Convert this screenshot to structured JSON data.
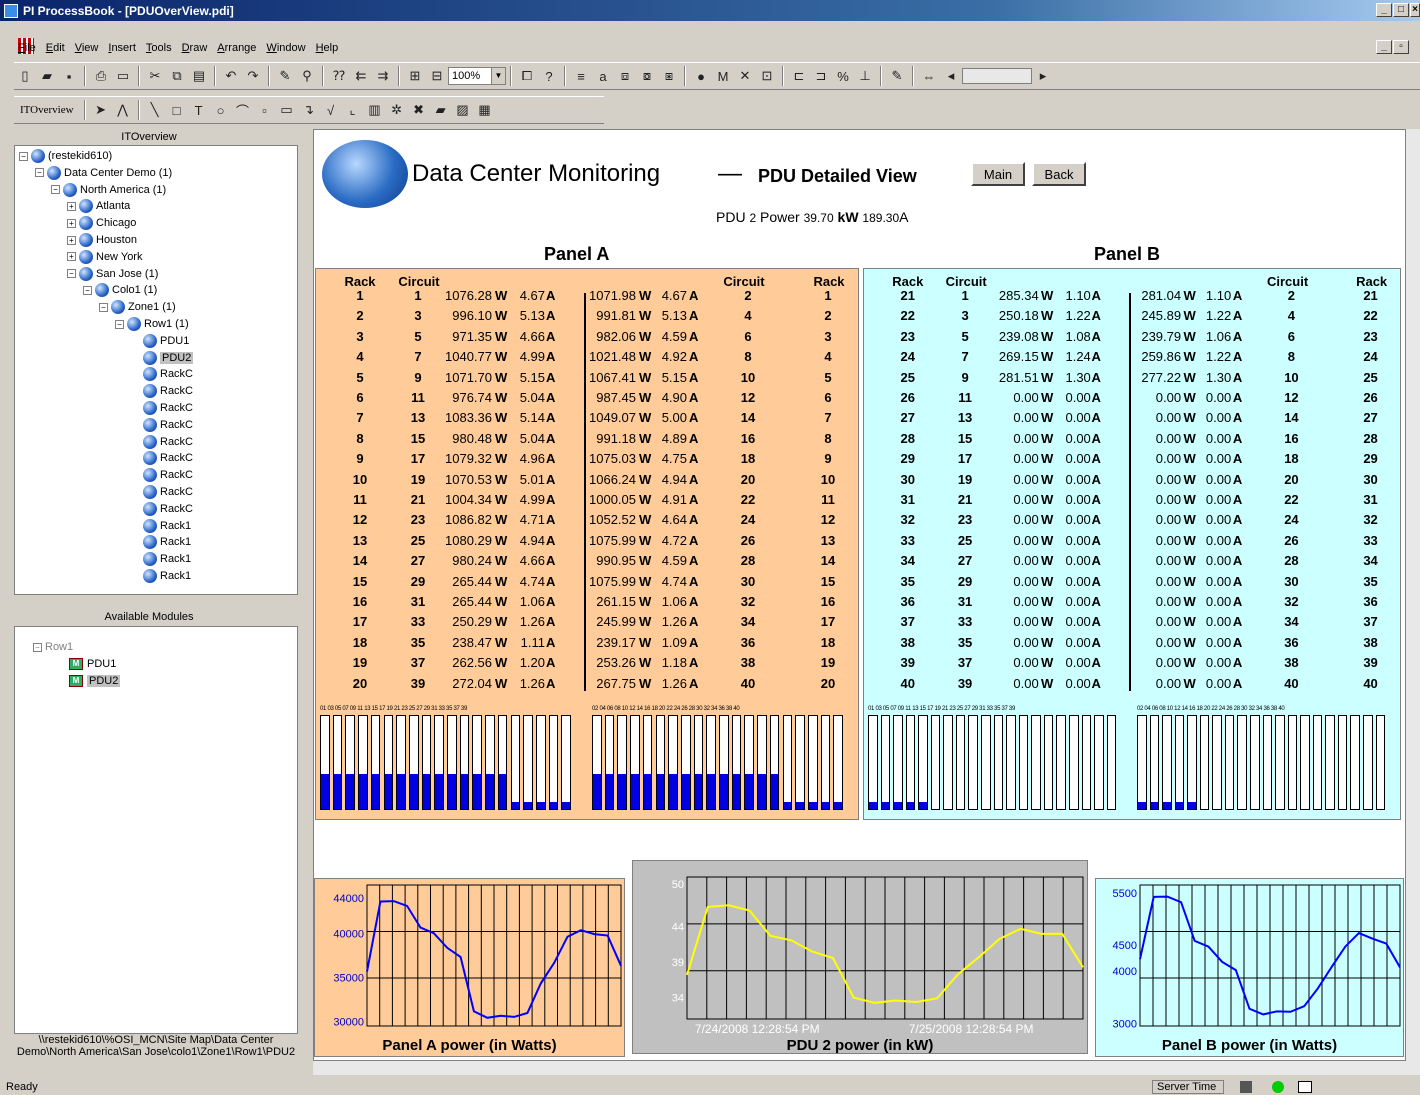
{
  "window": {
    "title": "PI ProcessBook - [PDUOverView.pdi]"
  },
  "menu": [
    "File",
    "Edit",
    "View",
    "Insert",
    "Tools",
    "Draw",
    "Arrange",
    "Window",
    "Help"
  ],
  "toolbar": {
    "zoom": "100%",
    "display_name": "ITOverview"
  },
  "tree_pane": {
    "title": "ITOverview",
    "nodes": [
      {
        "label": "(restekid610)",
        "depth": 0,
        "expander": "−"
      },
      {
        "label": "Data Center Demo (1)",
        "depth": 1,
        "expander": "−"
      },
      {
        "label": "North America (1)",
        "depth": 2,
        "expander": "−"
      },
      {
        "label": "Atlanta",
        "depth": 3,
        "expander": "+"
      },
      {
        "label": "Chicago",
        "depth": 3,
        "expander": "+"
      },
      {
        "label": "Houston",
        "depth": 3,
        "expander": "+"
      },
      {
        "label": "New York",
        "depth": 3,
        "expander": "+"
      },
      {
        "label": "San Jose (1)",
        "depth": 3,
        "expander": "−"
      },
      {
        "label": "Colo1 (1)",
        "depth": 4,
        "expander": "−"
      },
      {
        "label": "Zone1 (1)",
        "depth": 5,
        "expander": "−"
      },
      {
        "label": "Row1 (1)",
        "depth": 6,
        "expander": "−"
      },
      {
        "label": "PDU1",
        "depth": 7,
        "expander": ""
      },
      {
        "label": "PDU2",
        "depth": 7,
        "expander": "",
        "selected": true
      },
      {
        "label": "RackC",
        "depth": 7,
        "expander": ""
      },
      {
        "label": "RackC",
        "depth": 7,
        "expander": ""
      },
      {
        "label": "RackC",
        "depth": 7,
        "expander": ""
      },
      {
        "label": "RackC",
        "depth": 7,
        "expander": ""
      },
      {
        "label": "RackC",
        "depth": 7,
        "expander": ""
      },
      {
        "label": "RackC",
        "depth": 7,
        "expander": ""
      },
      {
        "label": "RackC",
        "depth": 7,
        "expander": ""
      },
      {
        "label": "RackC",
        "depth": 7,
        "expander": ""
      },
      {
        "label": "RackC",
        "depth": 7,
        "expander": ""
      },
      {
        "label": "Rack1",
        "depth": 7,
        "expander": ""
      },
      {
        "label": "Rack1",
        "depth": 7,
        "expander": ""
      },
      {
        "label": "Rack1",
        "depth": 7,
        "expander": ""
      },
      {
        "label": "Rack1",
        "depth": 7,
        "expander": ""
      }
    ]
  },
  "modules_pane": {
    "title": "Available Modules",
    "root": "Row1",
    "items": [
      "PDU1",
      "PDU2"
    ],
    "path": "\\\\restekid610\\%OSI_MCN\\Site Map\\Data Center Demo\\North America\\San Jose\\colo1\\Zone1\\Row1\\PDU2"
  },
  "display": {
    "title": "Data Center Monitoring",
    "dash": "—",
    "subtitle": "PDU Detailed View",
    "main_button": "Main",
    "back_button": "Back",
    "pdu_prefix": "PDU",
    "pdu_number": "2",
    "power_label": "Power",
    "kw_value": "39.70",
    "kw_unit": "kW",
    "amp_value": "189.30",
    "amp_unit": "A",
    "rack_hdr": "Rack",
    "circuit_hdr": "Circuit",
    "w_unit": "W",
    "a_unit": "A",
    "bar_ticks_odd": "01 03 05 07 09 11 13 15 17 19 21 23 25 27 29 31 33 35 37 39",
    "bar_ticks_even": "02 04 06 08 10 12 14 16 18 20 22 24 26 28 30 32 34 36 38 40"
  },
  "panel_a": {
    "title": "Panel A",
    "rows": [
      {
        "rack": "1",
        "lc": "1",
        "lw": "1076.28",
        "la": "4.67",
        "rw": "1071.98",
        "ra": "4.67",
        "rc": "2",
        "rr": "1"
      },
      {
        "rack": "2",
        "lc": "3",
        "lw": "996.10",
        "la": "5.13",
        "rw": "991.81",
        "ra": "5.13",
        "rc": "4",
        "rr": "2"
      },
      {
        "rack": "3",
        "lc": "5",
        "lw": "971.35",
        "la": "4.66",
        "rw": "982.06",
        "ra": "4.59",
        "rc": "6",
        "rr": "3"
      },
      {
        "rack": "4",
        "lc": "7",
        "lw": "1040.77",
        "la": "4.99",
        "rw": "1021.48",
        "ra": "4.92",
        "rc": "8",
        "rr": "4"
      },
      {
        "rack": "5",
        "lc": "9",
        "lw": "1071.70",
        "la": "5.15",
        "rw": "1067.41",
        "ra": "5.15",
        "rc": "10",
        "rr": "5"
      },
      {
        "rack": "6",
        "lc": "11",
        "lw": "976.74",
        "la": "5.04",
        "rw": "987.45",
        "ra": "4.90",
        "rc": "12",
        "rr": "6"
      },
      {
        "rack": "7",
        "lc": "13",
        "lw": "1083.36",
        "la": "5.14",
        "rw": "1049.07",
        "ra": "5.00",
        "rc": "14",
        "rr": "7"
      },
      {
        "rack": "8",
        "lc": "15",
        "lw": "980.48",
        "la": "5.04",
        "rw": "991.18",
        "ra": "4.89",
        "rc": "16",
        "rr": "8"
      },
      {
        "rack": "9",
        "lc": "17",
        "lw": "1079.32",
        "la": "4.96",
        "rw": "1075.03",
        "ra": "4.75",
        "rc": "18",
        "rr": "9"
      },
      {
        "rack": "10",
        "lc": "19",
        "lw": "1070.53",
        "la": "5.01",
        "rw": "1066.24",
        "ra": "4.94",
        "rc": "20",
        "rr": "10"
      },
      {
        "rack": "11",
        "lc": "21",
        "lw": "1004.34",
        "la": "4.99",
        "rw": "1000.05",
        "ra": "4.91",
        "rc": "22",
        "rr": "11"
      },
      {
        "rack": "12",
        "lc": "23",
        "lw": "1086.82",
        "la": "4.71",
        "rw": "1052.52",
        "ra": "4.64",
        "rc": "24",
        "rr": "12"
      },
      {
        "rack": "13",
        "lc": "25",
        "lw": "1080.29",
        "la": "4.94",
        "rw": "1075.99",
        "ra": "4.72",
        "rc": "26",
        "rr": "13"
      },
      {
        "rack": "14",
        "lc": "27",
        "lw": "980.24",
        "la": "4.66",
        "rw": "990.95",
        "ra": "4.59",
        "rc": "28",
        "rr": "14"
      },
      {
        "rack": "15",
        "lc": "29",
        "lw": "265.44",
        "la": "4.74",
        "rw": "1075.99",
        "ra": "4.74",
        "rc": "30",
        "rr": "15"
      },
      {
        "rack": "16",
        "lc": "31",
        "lw": "265.44",
        "la": "1.06",
        "rw": "261.15",
        "ra": "1.06",
        "rc": "32",
        "rr": "16"
      },
      {
        "rack": "17",
        "lc": "33",
        "lw": "250.29",
        "la": "1.26",
        "rw": "245.99",
        "ra": "1.26",
        "rc": "34",
        "rr": "17"
      },
      {
        "rack": "18",
        "lc": "35",
        "lw": "238.47",
        "la": "1.11",
        "rw": "239.17",
        "ra": "1.09",
        "rc": "36",
        "rr": "18"
      },
      {
        "rack": "19",
        "lc": "37",
        "lw": "262.56",
        "la": "1.20",
        "rw": "253.26",
        "ra": "1.18",
        "rc": "38",
        "rr": "19"
      },
      {
        "rack": "20",
        "lc": "39",
        "lw": "272.04",
        "la": "1.26",
        "rw": "267.75",
        "ra": "1.26",
        "rc": "40",
        "rr": "20"
      }
    ],
    "bar_levels_left": [
      0.38,
      0.38,
      0.38,
      0.38,
      0.38,
      0.38,
      0.38,
      0.38,
      0.38,
      0.38,
      0.38,
      0.38,
      0.38,
      0.38,
      0.38,
      0.08,
      0.08,
      0.08,
      0.08,
      0.08
    ],
    "bar_levels_right": [
      0.38,
      0.38,
      0.38,
      0.38,
      0.38,
      0.38,
      0.38,
      0.38,
      0.38,
      0.38,
      0.38,
      0.38,
      0.38,
      0.38,
      0.38,
      0.08,
      0.08,
      0.08,
      0.08,
      0.08
    ]
  },
  "panel_b": {
    "title": "Panel B",
    "rows": [
      {
        "rack": "21",
        "lc": "1",
        "lw": "285.34",
        "la": "1.10",
        "rw": "281.04",
        "ra": "1.10",
        "rc": "2",
        "rr": "21"
      },
      {
        "rack": "22",
        "lc": "3",
        "lw": "250.18",
        "la": "1.22",
        "rw": "245.89",
        "ra": "1.22",
        "rc": "4",
        "rr": "22"
      },
      {
        "rack": "23",
        "lc": "5",
        "lw": "239.08",
        "la": "1.08",
        "rw": "239.79",
        "ra": "1.06",
        "rc": "6",
        "rr": "23"
      },
      {
        "rack": "24",
        "lc": "7",
        "lw": "269.15",
        "la": "1.24",
        "rw": "259.86",
        "ra": "1.22",
        "rc": "8",
        "rr": "24"
      },
      {
        "rack": "25",
        "lc": "9",
        "lw": "281.51",
        "la": "1.30",
        "rw": "277.22",
        "ra": "1.30",
        "rc": "10",
        "rr": "25"
      },
      {
        "rack": "26",
        "lc": "11",
        "lw": "0.00",
        "la": "0.00",
        "rw": "0.00",
        "ra": "0.00",
        "rc": "12",
        "rr": "26"
      },
      {
        "rack": "27",
        "lc": "13",
        "lw": "0.00",
        "la": "0.00",
        "rw": "0.00",
        "ra": "0.00",
        "rc": "14",
        "rr": "27"
      },
      {
        "rack": "28",
        "lc": "15",
        "lw": "0.00",
        "la": "0.00",
        "rw": "0.00",
        "ra": "0.00",
        "rc": "16",
        "rr": "28"
      },
      {
        "rack": "29",
        "lc": "17",
        "lw": "0.00",
        "la": "0.00",
        "rw": "0.00",
        "ra": "0.00",
        "rc": "18",
        "rr": "29"
      },
      {
        "rack": "30",
        "lc": "19",
        "lw": "0.00",
        "la": "0.00",
        "rw": "0.00",
        "ra": "0.00",
        "rc": "20",
        "rr": "30"
      },
      {
        "rack": "31",
        "lc": "21",
        "lw": "0.00",
        "la": "0.00",
        "rw": "0.00",
        "ra": "0.00",
        "rc": "22",
        "rr": "31"
      },
      {
        "rack": "32",
        "lc": "23",
        "lw": "0.00",
        "la": "0.00",
        "rw": "0.00",
        "ra": "0.00",
        "rc": "24",
        "rr": "32"
      },
      {
        "rack": "33",
        "lc": "25",
        "lw": "0.00",
        "la": "0.00",
        "rw": "0.00",
        "ra": "0.00",
        "rc": "26",
        "rr": "33"
      },
      {
        "rack": "34",
        "lc": "27",
        "lw": "0.00",
        "la": "0.00",
        "rw": "0.00",
        "ra": "0.00",
        "rc": "28",
        "rr": "34"
      },
      {
        "rack": "35",
        "lc": "29",
        "lw": "0.00",
        "la": "0.00",
        "rw": "0.00",
        "ra": "0.00",
        "rc": "30",
        "rr": "35"
      },
      {
        "rack": "36",
        "lc": "31",
        "lw": "0.00",
        "la": "0.00",
        "rw": "0.00",
        "ra": "0.00",
        "rc": "32",
        "rr": "36"
      },
      {
        "rack": "37",
        "lc": "33",
        "lw": "0.00",
        "la": "0.00",
        "rw": "0.00",
        "ra": "0.00",
        "rc": "34",
        "rr": "37"
      },
      {
        "rack": "38",
        "lc": "35",
        "lw": "0.00",
        "la": "0.00",
        "rw": "0.00",
        "ra": "0.00",
        "rc": "36",
        "rr": "38"
      },
      {
        "rack": "39",
        "lc": "37",
        "lw": "0.00",
        "la": "0.00",
        "rw": "0.00",
        "ra": "0.00",
        "rc": "38",
        "rr": "39"
      },
      {
        "rack": "40",
        "lc": "39",
        "lw": "0.00",
        "la": "0.00",
        "rw": "0.00",
        "ra": "0.00",
        "rc": "40",
        "rr": "40"
      }
    ],
    "bar_levels_left": [
      0.08,
      0.08,
      0.08,
      0.08,
      0.08,
      0,
      0,
      0,
      0,
      0,
      0,
      0,
      0,
      0,
      0,
      0,
      0,
      0,
      0,
      0
    ],
    "bar_levels_right": [
      0.08,
      0.08,
      0.08,
      0.08,
      0.08,
      0,
      0,
      0,
      0,
      0,
      0,
      0,
      0,
      0,
      0,
      0,
      0,
      0,
      0,
      0
    ]
  },
  "colors": {
    "panel_a_bg": "#ffcc99",
    "panel_b_bg": "#ccffff",
    "bar_fill": "#0000e0",
    "trend_gray": "#c0c0c0",
    "trend_yellow": "#ffff00",
    "trend_blue": "#0000ff"
  },
  "chart_data": [
    {
      "type": "line",
      "title": "Panel A power (in Watts)",
      "ytick_labels": [
        "44000",
        "40000",
        "35000",
        "30000"
      ],
      "ylim": [
        29500,
        45500
      ],
      "series": [
        {
          "values": [
            35500,
            43800,
            43500,
            43300,
            40500,
            40200,
            38200,
            37500,
            31000,
            30600,
            30500,
            30700,
            30800,
            34500,
            36500,
            39800,
            40200,
            40100,
            39600,
            36500
          ]
        }
      ]
    },
    {
      "type": "line",
      "title": "PDU 2 power (in kW)",
      "ytick_labels": [
        "50",
        "44",
        "39",
        "34"
      ],
      "xtick_labels": [
        "7/24/2008 12:28:54 PM",
        "7/25/2008 12:28:54 PM"
      ],
      "ylim": [
        31,
        51
      ],
      "series": [
        {
          "values": [
            37,
            47,
            46.8,
            46.5,
            42.5,
            42.3,
            40.3,
            39.8,
            33.8,
            33.5,
            33.4,
            33.6,
            33.7,
            37.5,
            39.5,
            42.5,
            43.5,
            43.2,
            42.8,
            38.5
          ]
        }
      ]
    },
    {
      "type": "line",
      "title": "Panel B power (in Watts)",
      "ytick_labels": [
        "5500",
        "4500",
        "4000",
        "3000"
      ],
      "ylim": [
        2950,
        5650
      ],
      "series": [
        {
          "values": [
            4200,
            5450,
            5400,
            5350,
            4550,
            4500,
            4150,
            4050,
            3250,
            3200,
            3200,
            3250,
            3300,
            3700,
            4050,
            4500,
            4700,
            4650,
            4500,
            4100
          ]
        }
      ]
    }
  ]
}
